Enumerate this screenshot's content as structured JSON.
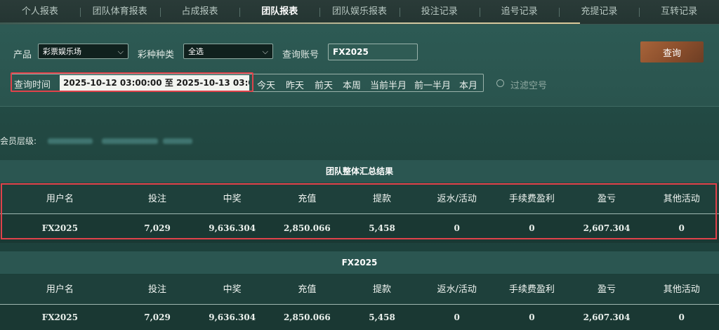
{
  "tabs": [
    {
      "label": "个人报表",
      "active": false
    },
    {
      "label": "团队体育报表",
      "active": false
    },
    {
      "label": "占成报表",
      "active": false
    },
    {
      "label": "团队报表",
      "active": true
    },
    {
      "label": "团队娱乐报表",
      "active": false
    },
    {
      "label": "投注记录",
      "active": false
    },
    {
      "label": "追号记录",
      "active": false
    },
    {
      "label": "充提记录",
      "active": false
    },
    {
      "label": "互转记录",
      "active": false
    }
  ],
  "filter": {
    "product_label": "产品",
    "product_value": "彩票娱乐场",
    "lottery_type_label": "彩种种类",
    "lottery_type_value": "全选",
    "account_label": "查询账号",
    "account_value": "FX2025",
    "query_button": "查询",
    "time_label": "查询时间",
    "date_range": "2025-10-12 03:00:00 至 2025-10-13 03:00:00",
    "quick_ranges": [
      "今天",
      "昨天",
      "前天",
      "本周",
      "当前半月",
      "前一半月",
      "本月"
    ],
    "filter_empty_label": "过滤空号"
  },
  "member_level_label": "会员层级:",
  "summary": {
    "title": "团队整体汇总结果",
    "columns": [
      "用户名",
      "投注",
      "中奖",
      "充值",
      "提款",
      "返水/活动",
      "手续费盈利",
      "盈亏",
      "其他活动"
    ],
    "rows": [
      [
        "FX2025",
        "7,029",
        "9,636.304",
        "2,850.066",
        "5,458",
        "0",
        "0",
        "2,607.304",
        "0"
      ]
    ]
  },
  "detail": {
    "title": "FX2025",
    "columns": [
      "用户名",
      "投注",
      "中奖",
      "充值",
      "提款",
      "返水/活动",
      "手续费盈利",
      "盈亏",
      "其他活动"
    ],
    "rows": [
      [
        "FX2025",
        "7,029",
        "9,636.304",
        "2,850.066",
        "5,458",
        "0",
        "0",
        "2,607.304",
        "0"
      ]
    ]
  },
  "colors": {
    "accent_red": "#e0424a",
    "button_brown": "#a7643a",
    "background": "#214741"
  }
}
